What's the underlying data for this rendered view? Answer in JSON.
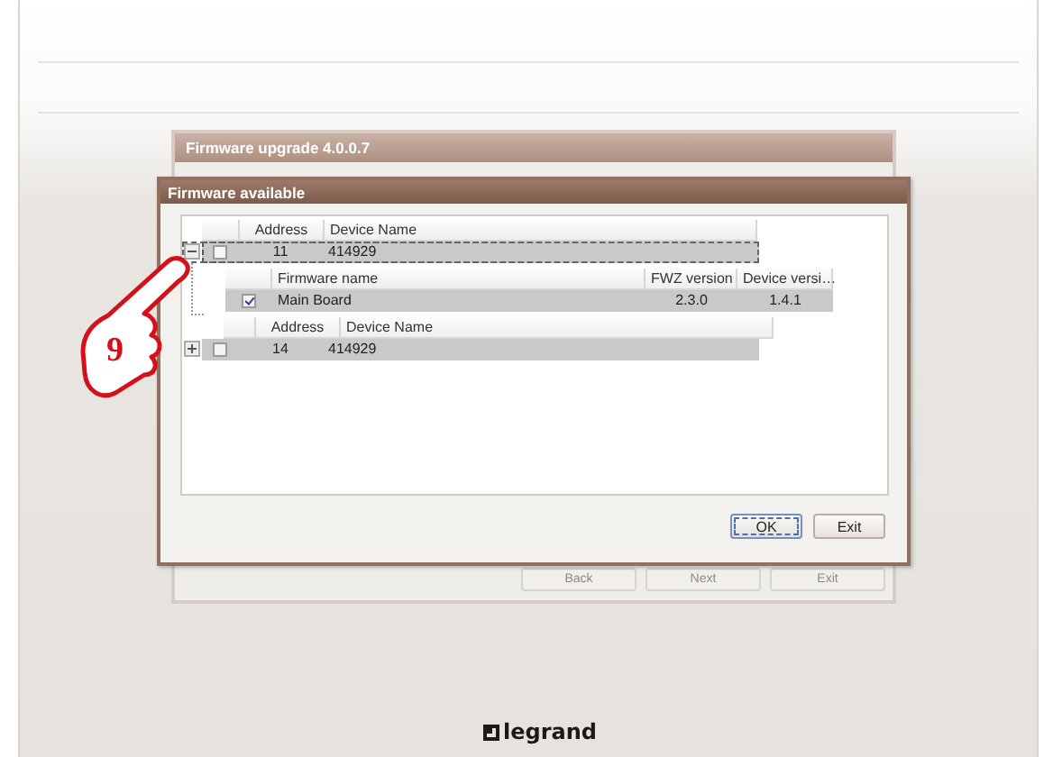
{
  "background_window": {
    "title": "Firmware upgrade 4.0.0.7",
    "buttons": [
      "Back",
      "Next",
      "Exit"
    ]
  },
  "dialog": {
    "title": "Firmware available",
    "devices": [
      {
        "columns": [
          "Address",
          "Device Name"
        ],
        "expanded": true,
        "checked": false,
        "selected": true,
        "address": "11",
        "device_name": "414929",
        "firmware": {
          "columns": [
            "Firmware name",
            "FWZ version",
            "Device versi…"
          ],
          "rows": [
            {
              "checked": true,
              "firmware_name": "Main Board",
              "fwz_version": "2.3.0",
              "device_version": "1.4.1"
            }
          ]
        }
      },
      {
        "columns": [
          "Address",
          "Device Name"
        ],
        "expanded": false,
        "checked": false,
        "selected": false,
        "address": "14",
        "device_name": "414929"
      }
    ],
    "buttons": [
      {
        "label": "OK",
        "focused": true
      },
      {
        "label": "Exit",
        "focused": false
      }
    ]
  },
  "callout": {
    "label": "9"
  },
  "footer": {
    "logo": "legrand"
  }
}
